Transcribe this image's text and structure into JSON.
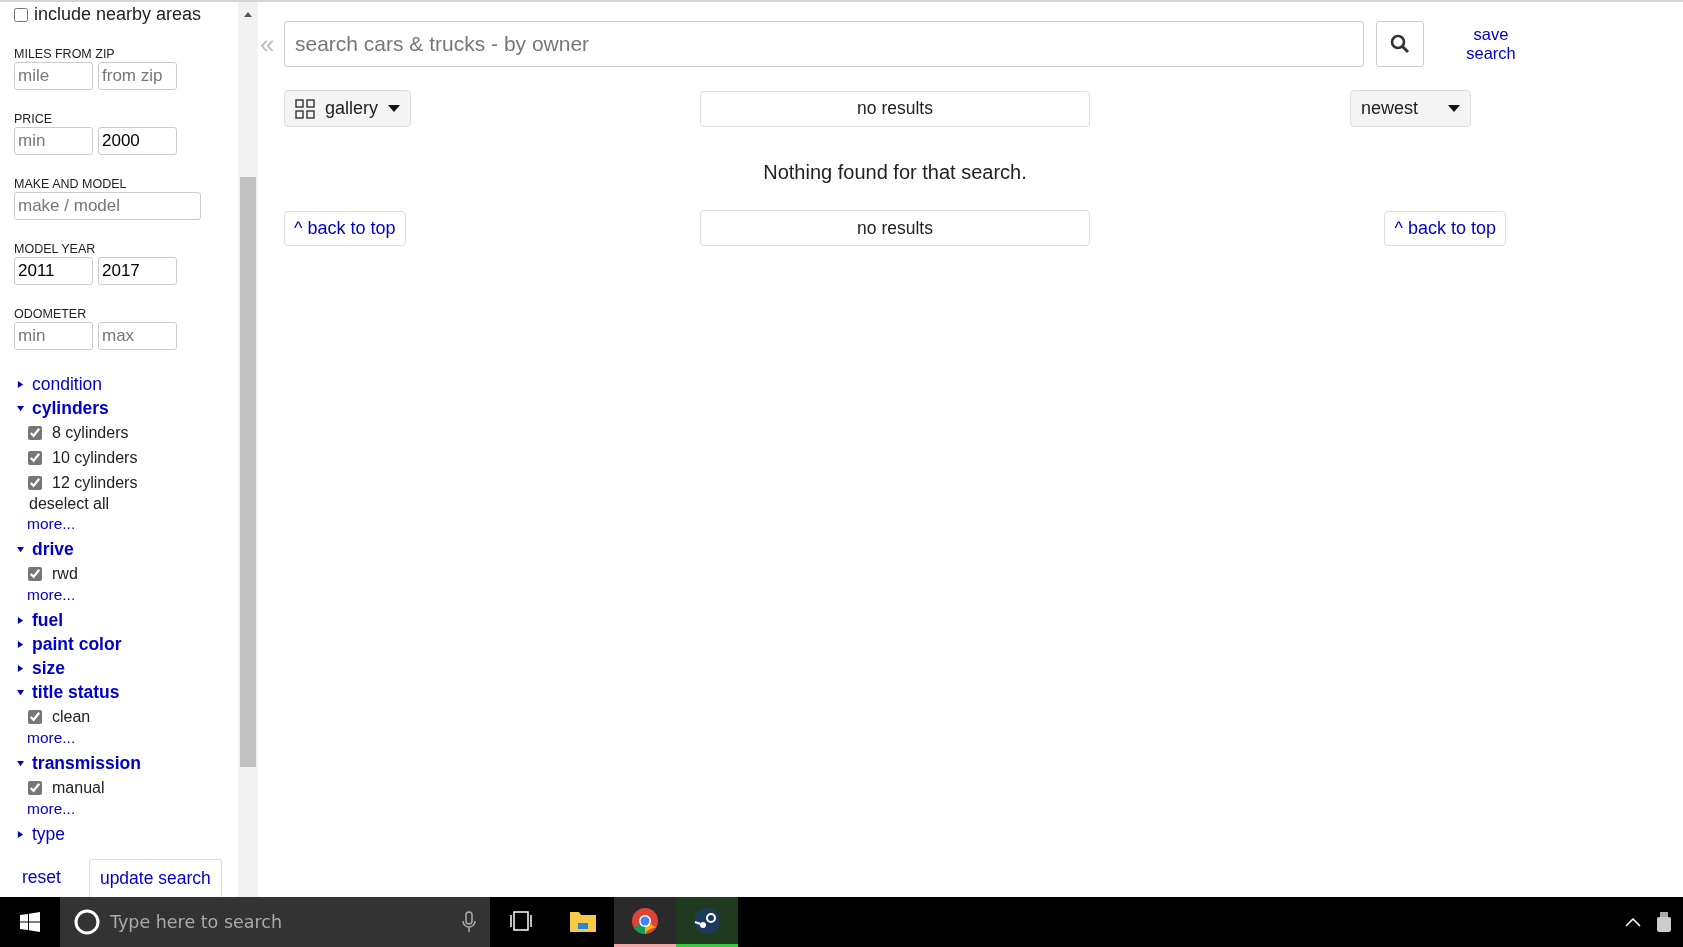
{
  "sidebar": {
    "nearby": {
      "label": "include nearby areas",
      "checked": false
    },
    "fields": [
      {
        "label": "MILES FROM ZIP",
        "inputs": [
          {
            "placeholder": "mile"
          },
          {
            "placeholder": "from zip"
          }
        ]
      },
      {
        "label": "PRICE",
        "inputs": [
          {
            "placeholder": "min"
          },
          {
            "value": "2000"
          }
        ]
      },
      {
        "label": "MAKE AND MODEL",
        "inputs": [
          {
            "placeholder": "make / model"
          }
        ]
      },
      {
        "label": "MODEL YEAR",
        "inputs": [
          {
            "value": "2011"
          },
          {
            "value": "2017"
          }
        ]
      },
      {
        "label": "ODOMETER",
        "inputs": [
          {
            "placeholder": "min"
          },
          {
            "placeholder": "max"
          }
        ]
      }
    ],
    "groups": [
      {
        "title": "condition",
        "expanded": false,
        "active": false
      },
      {
        "title": "cylinders",
        "expanded": true,
        "active": true,
        "items": [
          {
            "label": "8 cylinders",
            "checked": true
          },
          {
            "label": "10 cylinders",
            "checked": true
          },
          {
            "label": "12 cylinders",
            "checked": true
          }
        ],
        "deselect": "deselect all",
        "more": "more..."
      },
      {
        "title": "drive",
        "expanded": true,
        "active": true,
        "items": [
          {
            "label": "rwd",
            "checked": true
          }
        ],
        "more": "more..."
      },
      {
        "title": "fuel",
        "expanded": false,
        "active": true
      },
      {
        "title": "paint color",
        "expanded": false,
        "active": true
      },
      {
        "title": "size",
        "expanded": false,
        "active": true
      },
      {
        "title": "title status",
        "expanded": true,
        "active": true,
        "items": [
          {
            "label": "clean",
            "checked": true
          }
        ],
        "more": "more..."
      },
      {
        "title": "transmission",
        "expanded": true,
        "active": true,
        "items": [
          {
            "label": "manual",
            "checked": true
          }
        ],
        "more": "more..."
      },
      {
        "title": "type",
        "expanded": false,
        "active": false
      }
    ],
    "reset": "reset",
    "update": "update search"
  },
  "main": {
    "collapse": "«",
    "search": {
      "placeholder": "search cars & trucks - by owner"
    },
    "save_search": "save search",
    "view": "gallery",
    "results_top": "no results",
    "sort": "newest",
    "message": "Nothing found for that search.",
    "back_left": "^ back to top",
    "results_bottom": "no results",
    "back_right": "^ back to top"
  },
  "taskbar": {
    "search": {
      "placeholder": "Type here to search"
    }
  }
}
